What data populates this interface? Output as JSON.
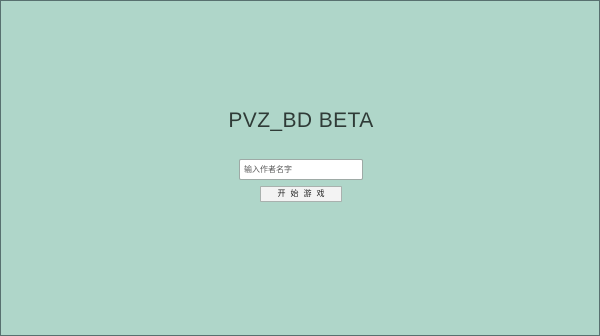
{
  "game": {
    "title": "PVZ_BD BETA"
  },
  "form": {
    "name_placeholder": "输入作者名字",
    "name_value": "",
    "start_label": "开始游戏"
  },
  "colors": {
    "background": "#afd6c9",
    "title_text": "#2f3b37",
    "button_bg": "#f3f3f3"
  }
}
